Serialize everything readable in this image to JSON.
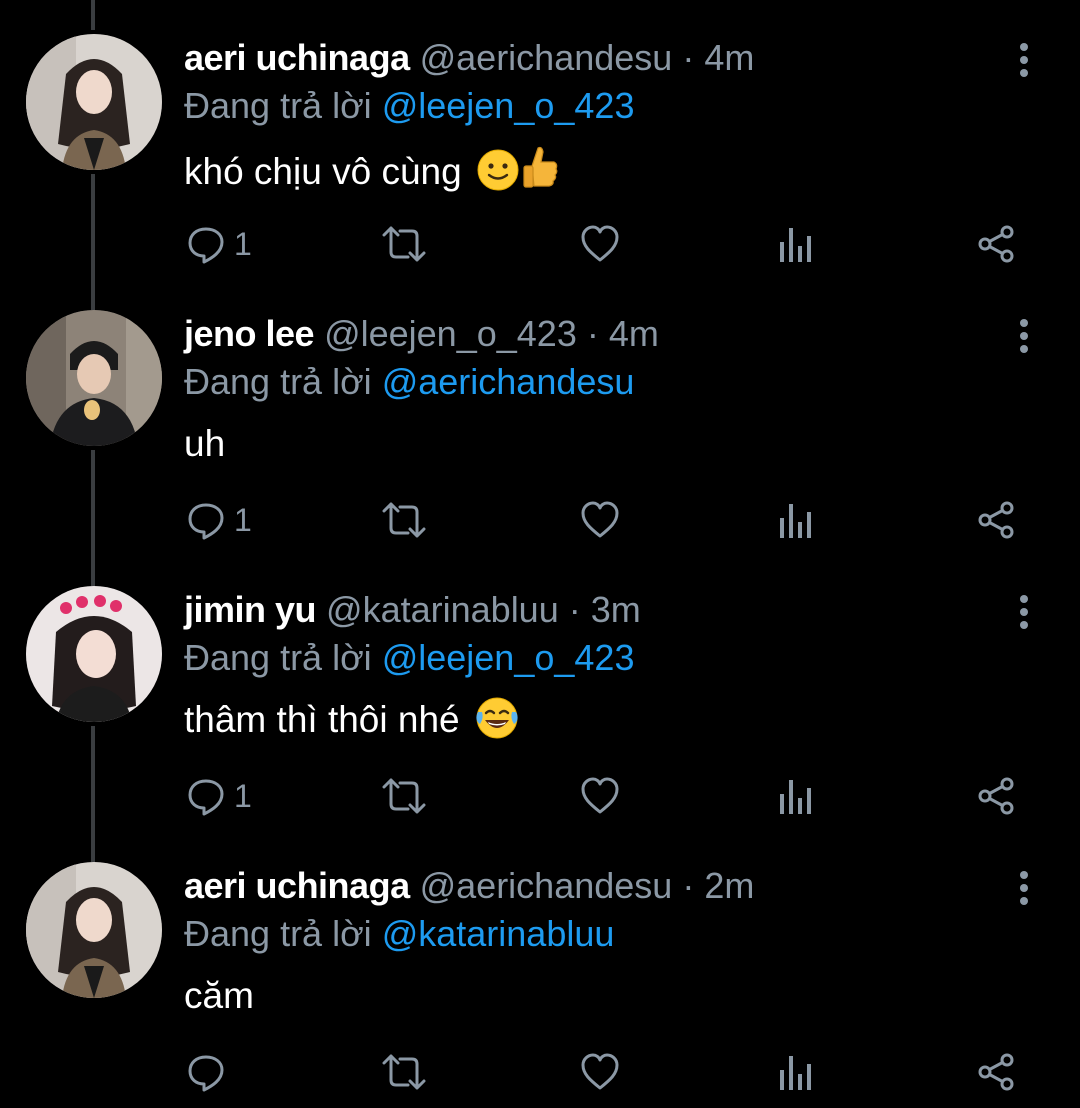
{
  "colors": {
    "background": "#000000",
    "text_primary": "#ffffff",
    "text_secondary": "#8b98a5",
    "accent": "#1d9bf0",
    "thread_line": "#3a3d40"
  },
  "reply_prefix": "Đang trả lời",
  "tweets": [
    {
      "display_name": "aeri uchinaga",
      "handle": "@aerichandesu",
      "separator": "·",
      "time": "4m",
      "reply_to": "@leejen_o_423",
      "text": "khó chịu vô cùng",
      "emojis": [
        "slightly-smiling-face",
        "thumbs-up"
      ],
      "reply_count": "1",
      "avatar": "aeri-avatar"
    },
    {
      "display_name": "jeno lee",
      "handle": "@leejen_o_423",
      "separator": "·",
      "time": "4m",
      "reply_to": "@aerichandesu",
      "text": "uh",
      "emojis": [],
      "reply_count": "1",
      "avatar": "jeno-avatar"
    },
    {
      "display_name": "jimin yu",
      "handle": "@katarinabluu",
      "separator": "·",
      "time": "3m",
      "reply_to": "@leejen_o_423",
      "text": "thâm thì thôi nhé",
      "emojis": [
        "face-with-tears-of-joy"
      ],
      "reply_count": "1",
      "avatar": "jimin-avatar"
    },
    {
      "display_name": "aeri uchinaga",
      "handle": "@aerichandesu",
      "separator": "·",
      "time": "2m",
      "reply_to": "@katarinabluu",
      "text": "căm",
      "emojis": [],
      "reply_count": "",
      "avatar": "aeri-avatar"
    }
  ],
  "action_icons": [
    "reply-icon",
    "retweet-icon",
    "like-icon",
    "analytics-icon",
    "share-icon"
  ]
}
